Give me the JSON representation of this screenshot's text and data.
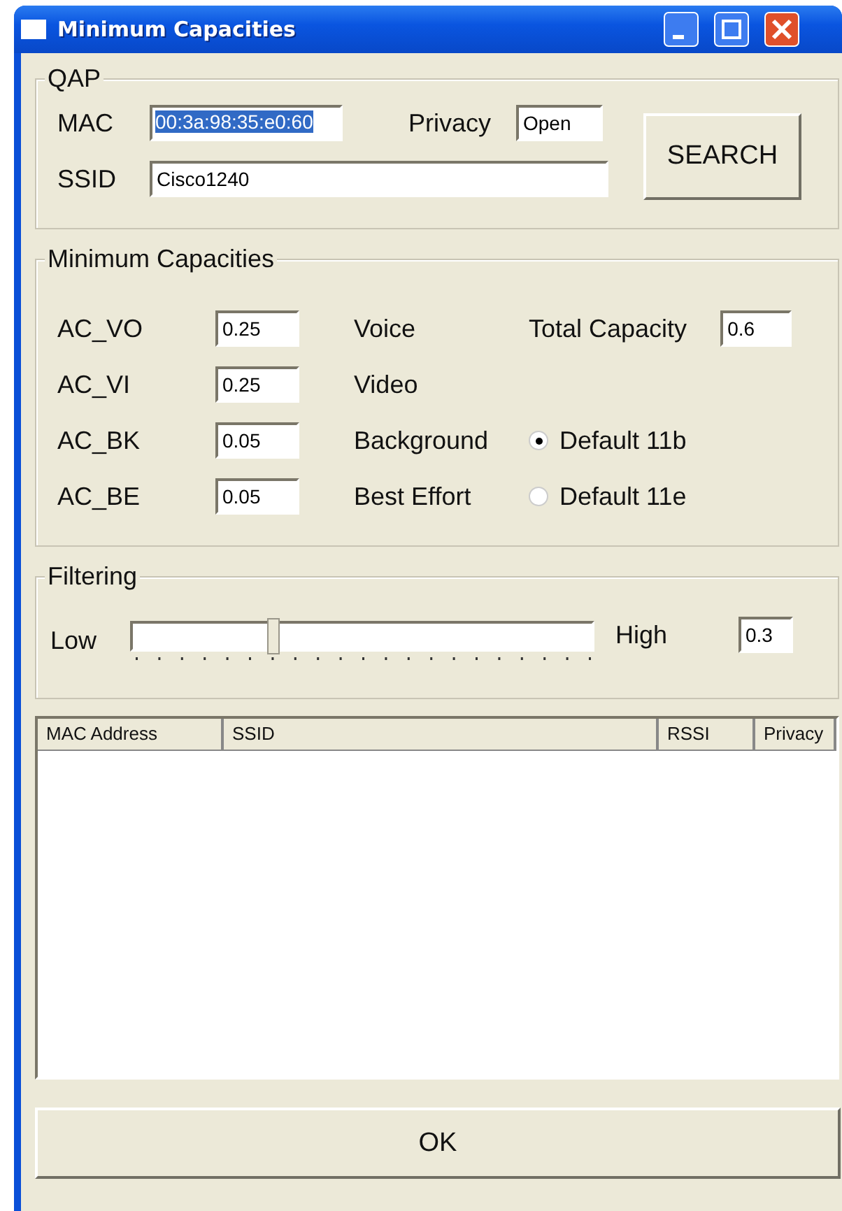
{
  "window": {
    "title": "Minimum Capacities"
  },
  "qap": {
    "title": "QAP",
    "mac_label": "MAC",
    "mac_value": "00:3a:98:35:e0:60",
    "mac_highlighted": true,
    "privacy_label": "Privacy",
    "privacy_value": "Open",
    "ssid_label": "SSID",
    "ssid_value": "Cisco1240",
    "search_button": "SEARCH"
  },
  "capacities": {
    "title": "Minimum Capacities",
    "rows": [
      {
        "code": "AC_VO",
        "value": "0.25",
        "name": "Voice"
      },
      {
        "code": "AC_VI",
        "value": "0.25",
        "name": "Video"
      },
      {
        "code": "AC_BK",
        "value": "0.05",
        "name": "Background"
      },
      {
        "code": "AC_BE",
        "value": "0.05",
        "name": "Best Effort"
      }
    ],
    "total_label": "Total Capacity",
    "total_value": "0.6",
    "radios": [
      {
        "label": "Default 11b",
        "selected": true
      },
      {
        "label": "Default 11e",
        "selected": false
      }
    ]
  },
  "filtering": {
    "title": "Filtering",
    "low_label": "Low",
    "high_label": "High",
    "level": 0.3,
    "value": "0.3"
  },
  "table": {
    "columns": [
      "MAC Address",
      "SSID",
      "RSSI",
      "Privacy"
    ]
  },
  "ok_button": "OK"
}
